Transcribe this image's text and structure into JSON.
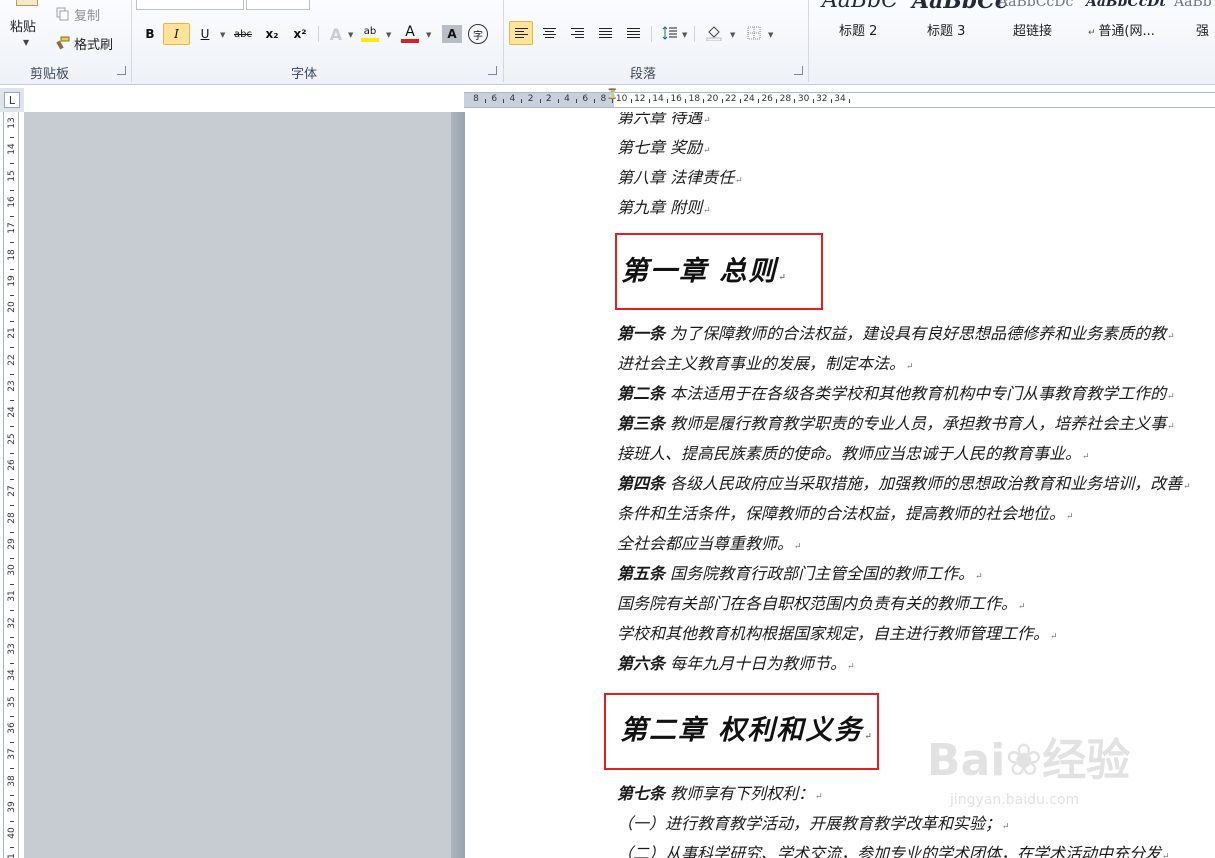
{
  "ribbon": {
    "clipboard": {
      "paste_label": "粘贴",
      "copy_label": "复制",
      "format_painter_label": "格式刷",
      "group_label": "剪贴板"
    },
    "font": {
      "group_label": "字体",
      "bold": "B",
      "italic": "I",
      "underline": "U",
      "strikethrough": "abc",
      "subscript": "x₂",
      "superscript": "x²",
      "text_effects": "A",
      "highlight": "ab",
      "font_color": "A",
      "char_shading": "A",
      "enclose": "字",
      "highlight_color": "#ffea00",
      "font_color_value": "#e02020"
    },
    "paragraph": {
      "group_label": "段落"
    },
    "styles": {
      "samples": [
        "AaBbC",
        "AaBbCc",
        "AaBbCcDc",
        "AaBbCcDt",
        "AaBb"
      ],
      "names": [
        "标题 2",
        "标题 3",
        "超链接",
        "普通(网...",
        "强"
      ]
    }
  },
  "ruler": {
    "h_labels": [
      "8",
      "6",
      "4",
      "2",
      "2",
      "4",
      "6",
      "8",
      "10",
      "12",
      "14",
      "16",
      "18",
      "20",
      "22",
      "24",
      "26",
      "28",
      "30",
      "32",
      "34"
    ],
    "v_labels": [
      "13",
      "14",
      "15",
      "16",
      "17",
      "18",
      "19",
      "20",
      "21",
      "22",
      "23",
      "24",
      "25",
      "26",
      "27",
      "28",
      "29",
      "30",
      "31",
      "32",
      "33",
      "34",
      "35",
      "36",
      "37",
      "38",
      "39",
      "40",
      "41"
    ],
    "tab_selector": "L"
  },
  "document": {
    "toc": [
      "第六章 待遇",
      "第七章 奖励",
      "第八章 法律责任",
      "第九章 附则"
    ],
    "chapter1_title": "第一章 总则",
    "chapter1_paragraphs": [
      {
        "bold": "第一条",
        "text": " 为了保障教师的合法权益，建设具有良好思想品德修养和业务素质的教"
      },
      {
        "bold": "",
        "text": "进社会主义教育事业的发展，制定本法。"
      },
      {
        "bold": "第二条",
        "text": " 本法适用于在各级各类学校和其他教育机构中专门从事教育教学工作的"
      },
      {
        "bold": "第三条",
        "text": " 教师是履行教育教学职责的专业人员，承担教书育人，培养社会主义事"
      },
      {
        "bold": "",
        "text": "接班人、提高民族素质的使命。教师应当忠诚于人民的教育事业。"
      },
      {
        "bold": "第四条",
        "text": " 各级人民政府应当采取措施，加强教师的思想政治教育和业务培训，改善"
      },
      {
        "bold": "",
        "text": "条件和生活条件，保障教师的合法权益，提高教师的社会地位。"
      },
      {
        "bold": "",
        "text": "全社会都应当尊重教师。"
      },
      {
        "bold": "第五条",
        "text": " 国务院教育行政部门主管全国的教师工作。"
      },
      {
        "bold": "",
        "text": "国务院有关部门在各自职权范围内负责有关的教师工作。"
      },
      {
        "bold": "",
        "text": "学校和其他教育机构根据国家规定，自主进行教师管理工作。"
      },
      {
        "bold": "第六条",
        "text": " 每年九月十日为教师节。"
      }
    ],
    "chapter2_title": "第二章 权利和义务",
    "chapter2_paragraphs": [
      {
        "bold": "第七条",
        "text": " 教师享有下列权利："
      },
      {
        "bold": "",
        "text": "（一）进行教育教学活动，开展教育教学改革和实验；"
      },
      {
        "bold": "",
        "text": "（二）从事科学研究、学术交流，参加专业的学术团体，在学术活动中充分发"
      }
    ],
    "paragraph_mark": "↵",
    "highlight_color": "#e0211f"
  },
  "watermark": {
    "brand": "Bai",
    "brand_cn": "经验",
    "url": "jingyan.baidu.com"
  }
}
